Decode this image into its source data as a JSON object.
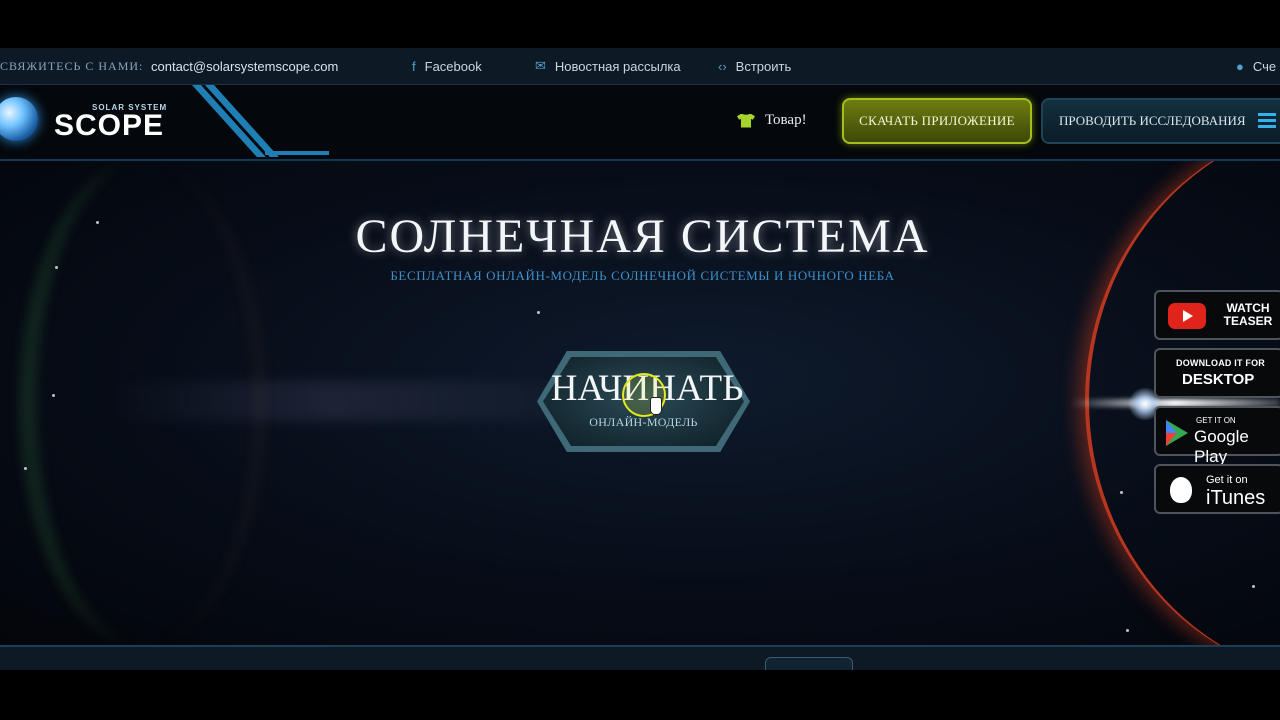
{
  "contact_bar": {
    "label": "Свяжитесь с нами:",
    "email": "contact@solarsystemscope.com",
    "facebook": "Facebook",
    "newsletter": "Новостная рассылка",
    "embed": "Встроить",
    "account": "Сче"
  },
  "header": {
    "logo_small": "SOLAR SYSTEM",
    "logo_big": "SCOPE",
    "merch": "Товар!",
    "download_app": "Скачать приложение",
    "explore": "Проводить исследования"
  },
  "hero": {
    "title": "СОЛНЕЧНАЯ  СИСТЕМА",
    "subtitle": "Бесплатная онлайн-модель Солнечной системы и ночного неба",
    "start_label": "НАЧИНАТЬ",
    "start_sub": "онлайн-модель"
  },
  "side_panel": {
    "teaser_line1": "WATCH",
    "teaser_line2": "TEASER",
    "desktop_small": "DOWNLOAD IT FOR",
    "desktop_big": "DESKTOP",
    "gplay_small": "GET IT ON",
    "gplay_big": "Google Play",
    "itunes_small": "Get it on",
    "itunes_big": "iTunes"
  },
  "colors": {
    "accent_blue": "#3f8fc9",
    "app_button_green": "#a4be1c",
    "youtube_red": "#e0241c"
  }
}
